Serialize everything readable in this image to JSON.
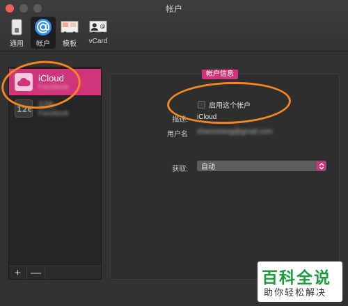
{
  "window": {
    "title": "帐户"
  },
  "toolbar": {
    "items": [
      {
        "label": "通用",
        "icon": "switch-icon",
        "selected": false
      },
      {
        "label": "帐户",
        "icon": "at-sign-icon",
        "selected": true
      },
      {
        "label": "模板",
        "icon": "template-icon",
        "selected": false
      },
      {
        "label": "vCard",
        "icon": "vcard-icon",
        "selected": false
      }
    ]
  },
  "sidebar": {
    "accounts": [
      {
        "name": "iCloud",
        "subtitle": "Facebook",
        "icon": "icloud-icon",
        "selected": true
      },
      {
        "name": "126",
        "subtitle": "Facebook",
        "icon": "mail-126-icon",
        "selected": false
      }
    ],
    "add_label": "+",
    "remove_label": "—"
  },
  "panel": {
    "title": "帐户信息",
    "enable_label": "启用这个帐户",
    "enabled": false,
    "description_label": "描述:",
    "description_value": "iCloud",
    "username_label": "用户名",
    "username_value": "zhaozixiang@gmail.com",
    "fetch_label": "获取:",
    "fetch_value": "自动"
  },
  "watermark": {
    "title": "百科全说",
    "subtitle": "助你轻松解决"
  },
  "colors": {
    "accent": "#d0347a",
    "annotation": "#f2871f",
    "selected_tab": "#1f1f1f"
  }
}
